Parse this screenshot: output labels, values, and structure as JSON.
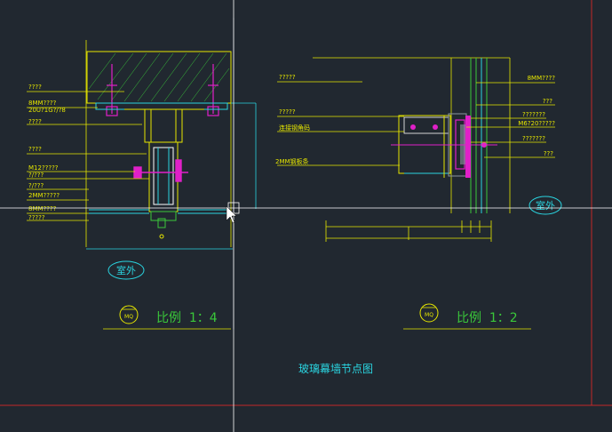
{
  "colors": {
    "background": "#212830",
    "yellow": "#e6e600",
    "green": "#3ac83a",
    "cyan": "#2ad4e0",
    "magenta": "#e020c8",
    "white": "#ffffff",
    "red": "#c42828",
    "gray": "#8c96a0",
    "crosshair": "#ffffff"
  },
  "left_detail": {
    "labels": [
      "????",
      "8MM????",
      "20U?1G?/?8",
      "????",
      "????",
      "M12?????",
      "?/???",
      "?/???",
      "2MM?????",
      "8MM????",
      "?????"
    ],
    "exterior_tag": "室外",
    "scale_symbol": "MQ",
    "scale_text": "比例  1：4"
  },
  "right_detail": {
    "labels_left": [
      "?????",
      "?????",
      "连接钢角码",
      "2MM钢板条"
    ],
    "labels_right": [
      "8MM????",
      "???",
      "???????",
      "M6?20?????",
      "???????",
      "???"
    ],
    "exterior_tag": "室外",
    "scale_symbol": "MQ",
    "scale_text": "比例  1：2"
  },
  "drawing_title": "玻璃幕墙节点图"
}
